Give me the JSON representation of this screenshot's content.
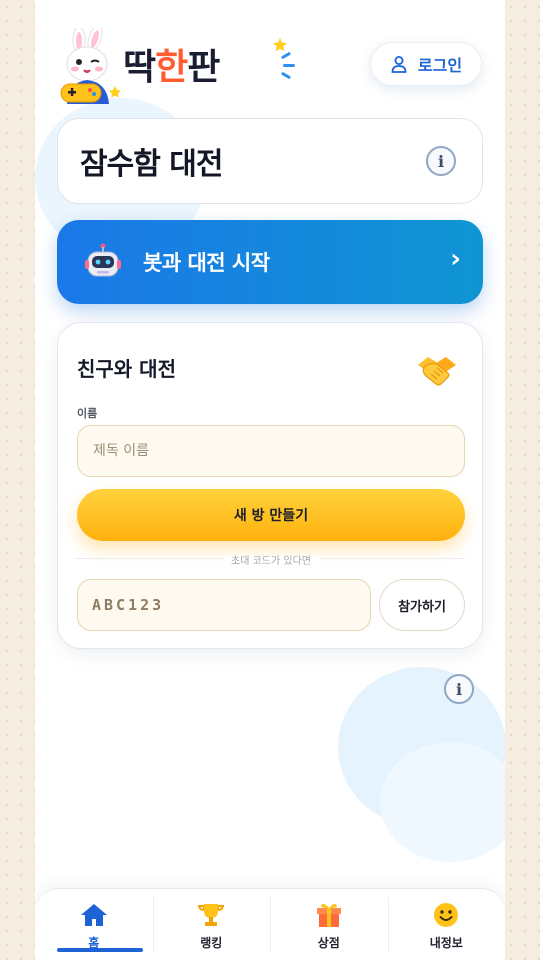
{
  "app": {
    "logo_parts": [
      "딱",
      "한",
      "판"
    ]
  },
  "header": {
    "login_label": "로그인"
  },
  "mode": {
    "title": "잠수함 대전",
    "info_icon": "info-icon"
  },
  "bot_match": {
    "label": "봇과 대전 시작",
    "icon": "robot-icon",
    "chevron": "›"
  },
  "friend_match": {
    "title": "친구와 대전",
    "icon": "handshake-icon",
    "name_label": "이름",
    "name_placeholder": "제독 이름",
    "create_label": "새 방 만들기",
    "divider_text": "초대 코드가 있다면",
    "code_placeholder": "ABC123",
    "join_label": "참가하기"
  },
  "nav": {
    "items": [
      {
        "label": "홈",
        "icon": "home-icon",
        "active": true
      },
      {
        "label": "랭킹",
        "icon": "trophy-icon",
        "active": false
      },
      {
        "label": "상점",
        "icon": "gift-icon",
        "active": false
      },
      {
        "label": "내정보",
        "icon": "smiley-icon",
        "active": false
      }
    ]
  },
  "colors": {
    "accent_blue": "#1e63d6",
    "bot_gradient_start": "#1b78e8",
    "bot_gradient_end": "#0f95d3",
    "create_gradient_start": "#ffd23d",
    "create_gradient_end": "#ffb10d",
    "logo_accent": "#ff5c32"
  }
}
